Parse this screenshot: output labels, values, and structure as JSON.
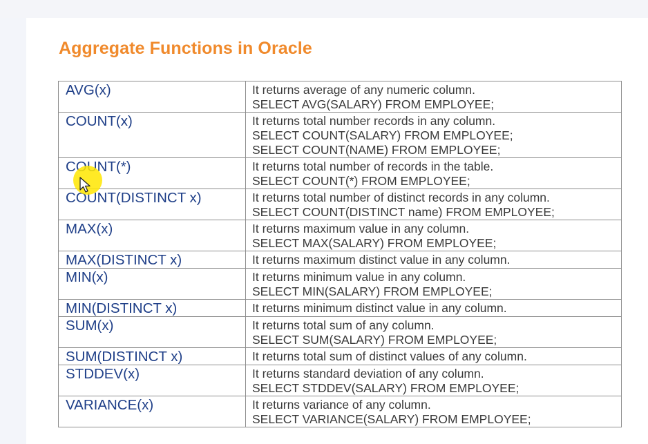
{
  "title": "Aggregate Functions in Oracle",
  "rows": [
    {
      "fn": "AVG(x)",
      "desc": [
        "It returns average of any numeric column.",
        "SELECT AVG(SALARY) FROM EMPLOYEE;"
      ]
    },
    {
      "fn": "COUNT(x)",
      "desc": [
        "It returns total number records in any column.",
        "SELECT COUNT(SALARY) FROM EMPLOYEE;",
        "SELECT COUNT(NAME) FROM EMPLOYEE;"
      ]
    },
    {
      "fn": "COUNT(*)",
      "desc": [
        "It returns total number of records in the table.",
        "SELECT COUNT(*) FROM EMPLOYEE;"
      ]
    },
    {
      "fn": "COUNT(DISTINCT x)",
      "desc": [
        "It returns total number of distinct records in any column.",
        "SELECT COUNT(DISTINCT name) FROM EMPLOYEE;"
      ]
    },
    {
      "fn": "MAX(x)",
      "desc": [
        "It returns maximum value in any column.",
        "SELECT MAX(SALARY) FROM EMPLOYEE;"
      ]
    },
    {
      "fn": "MAX(DISTINCT x)",
      "desc": [
        "It returns maximum distinct value in any column."
      ]
    },
    {
      "fn": "MIN(x)",
      "desc": [
        "It returns minimum value in any column.",
        "SELECT MIN(SALARY) FROM EMPLOYEE;"
      ]
    },
    {
      "fn": "MIN(DISTINCT x)",
      "desc": [
        "It returns minimum distinct value in any column."
      ]
    },
    {
      "fn": "SUM(x)",
      "desc": [
        "It returns total sum of any column.",
        "SELECT SUM(SALARY) FROM EMPLOYEE;"
      ]
    },
    {
      "fn": "SUM(DISTINCT x)",
      "desc": [
        "It returns total sum of distinct values of any column."
      ]
    },
    {
      "fn": "STDDEV(x)",
      "desc": [
        "It returns standard deviation of any column.",
        "SELECT STDDEV(SALARY) FROM EMPLOYEE;"
      ]
    },
    {
      "fn": "VARIANCE(x)",
      "desc": [
        "It returns variance of any column.",
        "SELECT VARIANCE(SALARY) FROM EMPLOYEE;"
      ]
    }
  ],
  "colors": {
    "title": "#f08a2c",
    "function_text": "#1f3f88",
    "description_text": "#3a3a3a",
    "cursor_highlight": "#ffe600"
  },
  "icons": {
    "cursor": "mouse-pointer-icon"
  }
}
